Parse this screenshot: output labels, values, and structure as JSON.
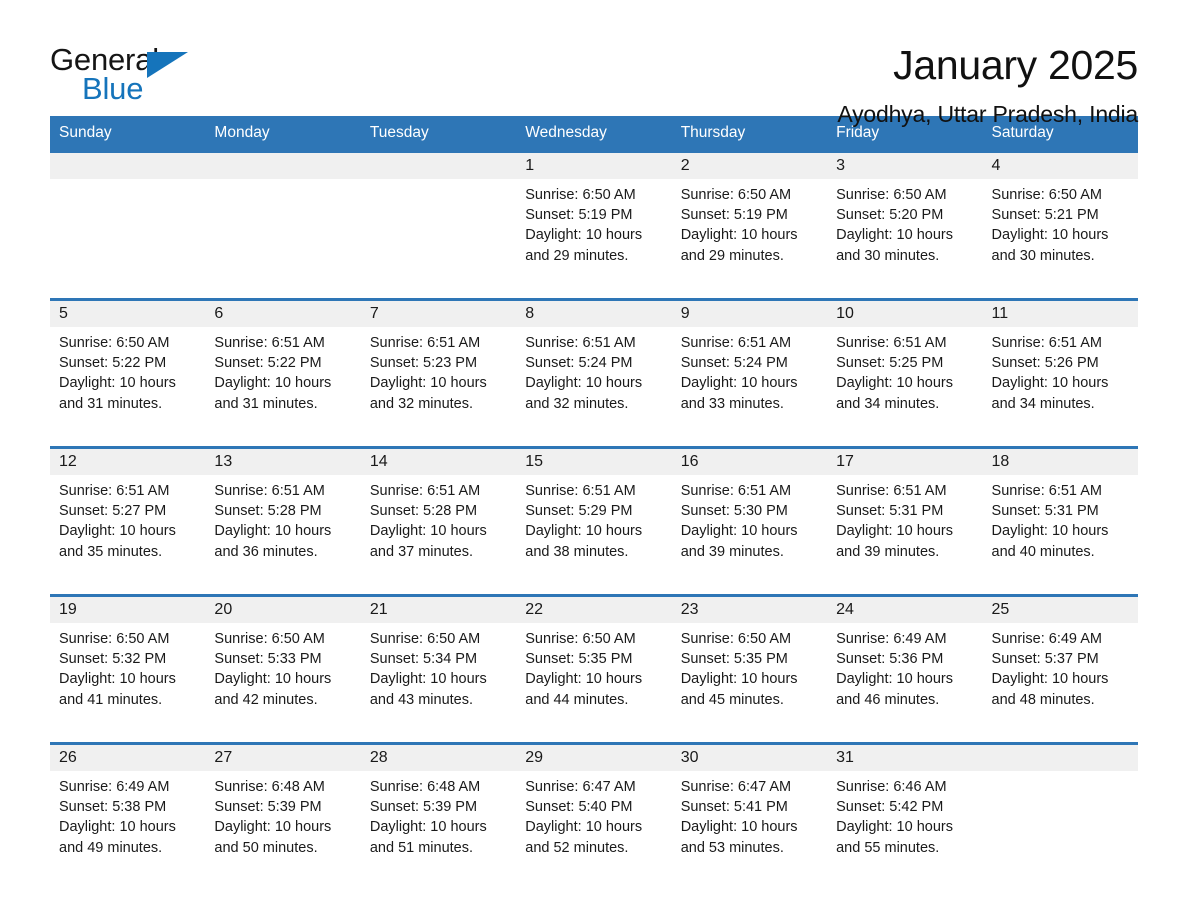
{
  "brand": {
    "name_part1": "General",
    "name_part2": "Blue",
    "triangle_icon": "triangle-icon",
    "accent_color": "#1574bb"
  },
  "header": {
    "title": "January 2025",
    "subtitle": "Ayodhya, Uttar Pradesh, India"
  },
  "theme": {
    "header_blue": "#2e76b6",
    "daynum_band": "#f0f0f0",
    "text": "#1a1a1a"
  },
  "calendar": {
    "weekday_headers": [
      "Sunday",
      "Monday",
      "Tuesday",
      "Wednesday",
      "Thursday",
      "Friday",
      "Saturday"
    ],
    "weeks": [
      [
        {
          "day": "",
          "lines": [
            "",
            "",
            "",
            ""
          ]
        },
        {
          "day": "",
          "lines": [
            "",
            "",
            "",
            ""
          ]
        },
        {
          "day": "",
          "lines": [
            "",
            "",
            "",
            ""
          ]
        },
        {
          "day": "1",
          "lines": [
            "Sunrise: 6:50 AM",
            "Sunset: 5:19 PM",
            "Daylight: 10 hours",
            "and 29 minutes."
          ]
        },
        {
          "day": "2",
          "lines": [
            "Sunrise: 6:50 AM",
            "Sunset: 5:19 PM",
            "Daylight: 10 hours",
            "and 29 minutes."
          ]
        },
        {
          "day": "3",
          "lines": [
            "Sunrise: 6:50 AM",
            "Sunset: 5:20 PM",
            "Daylight: 10 hours",
            "and 30 minutes."
          ]
        },
        {
          "day": "4",
          "lines": [
            "Sunrise: 6:50 AM",
            "Sunset: 5:21 PM",
            "Daylight: 10 hours",
            "and 30 minutes."
          ]
        }
      ],
      [
        {
          "day": "5",
          "lines": [
            "Sunrise: 6:50 AM",
            "Sunset: 5:22 PM",
            "Daylight: 10 hours",
            "and 31 minutes."
          ]
        },
        {
          "day": "6",
          "lines": [
            "Sunrise: 6:51 AM",
            "Sunset: 5:22 PM",
            "Daylight: 10 hours",
            "and 31 minutes."
          ]
        },
        {
          "day": "7",
          "lines": [
            "Sunrise: 6:51 AM",
            "Sunset: 5:23 PM",
            "Daylight: 10 hours",
            "and 32 minutes."
          ]
        },
        {
          "day": "8",
          "lines": [
            "Sunrise: 6:51 AM",
            "Sunset: 5:24 PM",
            "Daylight: 10 hours",
            "and 32 minutes."
          ]
        },
        {
          "day": "9",
          "lines": [
            "Sunrise: 6:51 AM",
            "Sunset: 5:24 PM",
            "Daylight: 10 hours",
            "and 33 minutes."
          ]
        },
        {
          "day": "10",
          "lines": [
            "Sunrise: 6:51 AM",
            "Sunset: 5:25 PM",
            "Daylight: 10 hours",
            "and 34 minutes."
          ]
        },
        {
          "day": "11",
          "lines": [
            "Sunrise: 6:51 AM",
            "Sunset: 5:26 PM",
            "Daylight: 10 hours",
            "and 34 minutes."
          ]
        }
      ],
      [
        {
          "day": "12",
          "lines": [
            "Sunrise: 6:51 AM",
            "Sunset: 5:27 PM",
            "Daylight: 10 hours",
            "and 35 minutes."
          ]
        },
        {
          "day": "13",
          "lines": [
            "Sunrise: 6:51 AM",
            "Sunset: 5:28 PM",
            "Daylight: 10 hours",
            "and 36 minutes."
          ]
        },
        {
          "day": "14",
          "lines": [
            "Sunrise: 6:51 AM",
            "Sunset: 5:28 PM",
            "Daylight: 10 hours",
            "and 37 minutes."
          ]
        },
        {
          "day": "15",
          "lines": [
            "Sunrise: 6:51 AM",
            "Sunset: 5:29 PM",
            "Daylight: 10 hours",
            "and 38 minutes."
          ]
        },
        {
          "day": "16",
          "lines": [
            "Sunrise: 6:51 AM",
            "Sunset: 5:30 PM",
            "Daylight: 10 hours",
            "and 39 minutes."
          ]
        },
        {
          "day": "17",
          "lines": [
            "Sunrise: 6:51 AM",
            "Sunset: 5:31 PM",
            "Daylight: 10 hours",
            "and 39 minutes."
          ]
        },
        {
          "day": "18",
          "lines": [
            "Sunrise: 6:51 AM",
            "Sunset: 5:31 PM",
            "Daylight: 10 hours",
            "and 40 minutes."
          ]
        }
      ],
      [
        {
          "day": "19",
          "lines": [
            "Sunrise: 6:50 AM",
            "Sunset: 5:32 PM",
            "Daylight: 10 hours",
            "and 41 minutes."
          ]
        },
        {
          "day": "20",
          "lines": [
            "Sunrise: 6:50 AM",
            "Sunset: 5:33 PM",
            "Daylight: 10 hours",
            "and 42 minutes."
          ]
        },
        {
          "day": "21",
          "lines": [
            "Sunrise: 6:50 AM",
            "Sunset: 5:34 PM",
            "Daylight: 10 hours",
            "and 43 minutes."
          ]
        },
        {
          "day": "22",
          "lines": [
            "Sunrise: 6:50 AM",
            "Sunset: 5:35 PM",
            "Daylight: 10 hours",
            "and 44 minutes."
          ]
        },
        {
          "day": "23",
          "lines": [
            "Sunrise: 6:50 AM",
            "Sunset: 5:35 PM",
            "Daylight: 10 hours",
            "and 45 minutes."
          ]
        },
        {
          "day": "24",
          "lines": [
            "Sunrise: 6:49 AM",
            "Sunset: 5:36 PM",
            "Daylight: 10 hours",
            "and 46 minutes."
          ]
        },
        {
          "day": "25",
          "lines": [
            "Sunrise: 6:49 AM",
            "Sunset: 5:37 PM",
            "Daylight: 10 hours",
            "and 48 minutes."
          ]
        }
      ],
      [
        {
          "day": "26",
          "lines": [
            "Sunrise: 6:49 AM",
            "Sunset: 5:38 PM",
            "Daylight: 10 hours",
            "and 49 minutes."
          ]
        },
        {
          "day": "27",
          "lines": [
            "Sunrise: 6:48 AM",
            "Sunset: 5:39 PM",
            "Daylight: 10 hours",
            "and 50 minutes."
          ]
        },
        {
          "day": "28",
          "lines": [
            "Sunrise: 6:48 AM",
            "Sunset: 5:39 PM",
            "Daylight: 10 hours",
            "and 51 minutes."
          ]
        },
        {
          "day": "29",
          "lines": [
            "Sunrise: 6:47 AM",
            "Sunset: 5:40 PM",
            "Daylight: 10 hours",
            "and 52 minutes."
          ]
        },
        {
          "day": "30",
          "lines": [
            "Sunrise: 6:47 AM",
            "Sunset: 5:41 PM",
            "Daylight: 10 hours",
            "and 53 minutes."
          ]
        },
        {
          "day": "31",
          "lines": [
            "Sunrise: 6:46 AM",
            "Sunset: 5:42 PM",
            "Daylight: 10 hours",
            "and 55 minutes."
          ]
        },
        {
          "day": "",
          "lines": [
            "",
            "",
            "",
            ""
          ]
        }
      ]
    ]
  }
}
